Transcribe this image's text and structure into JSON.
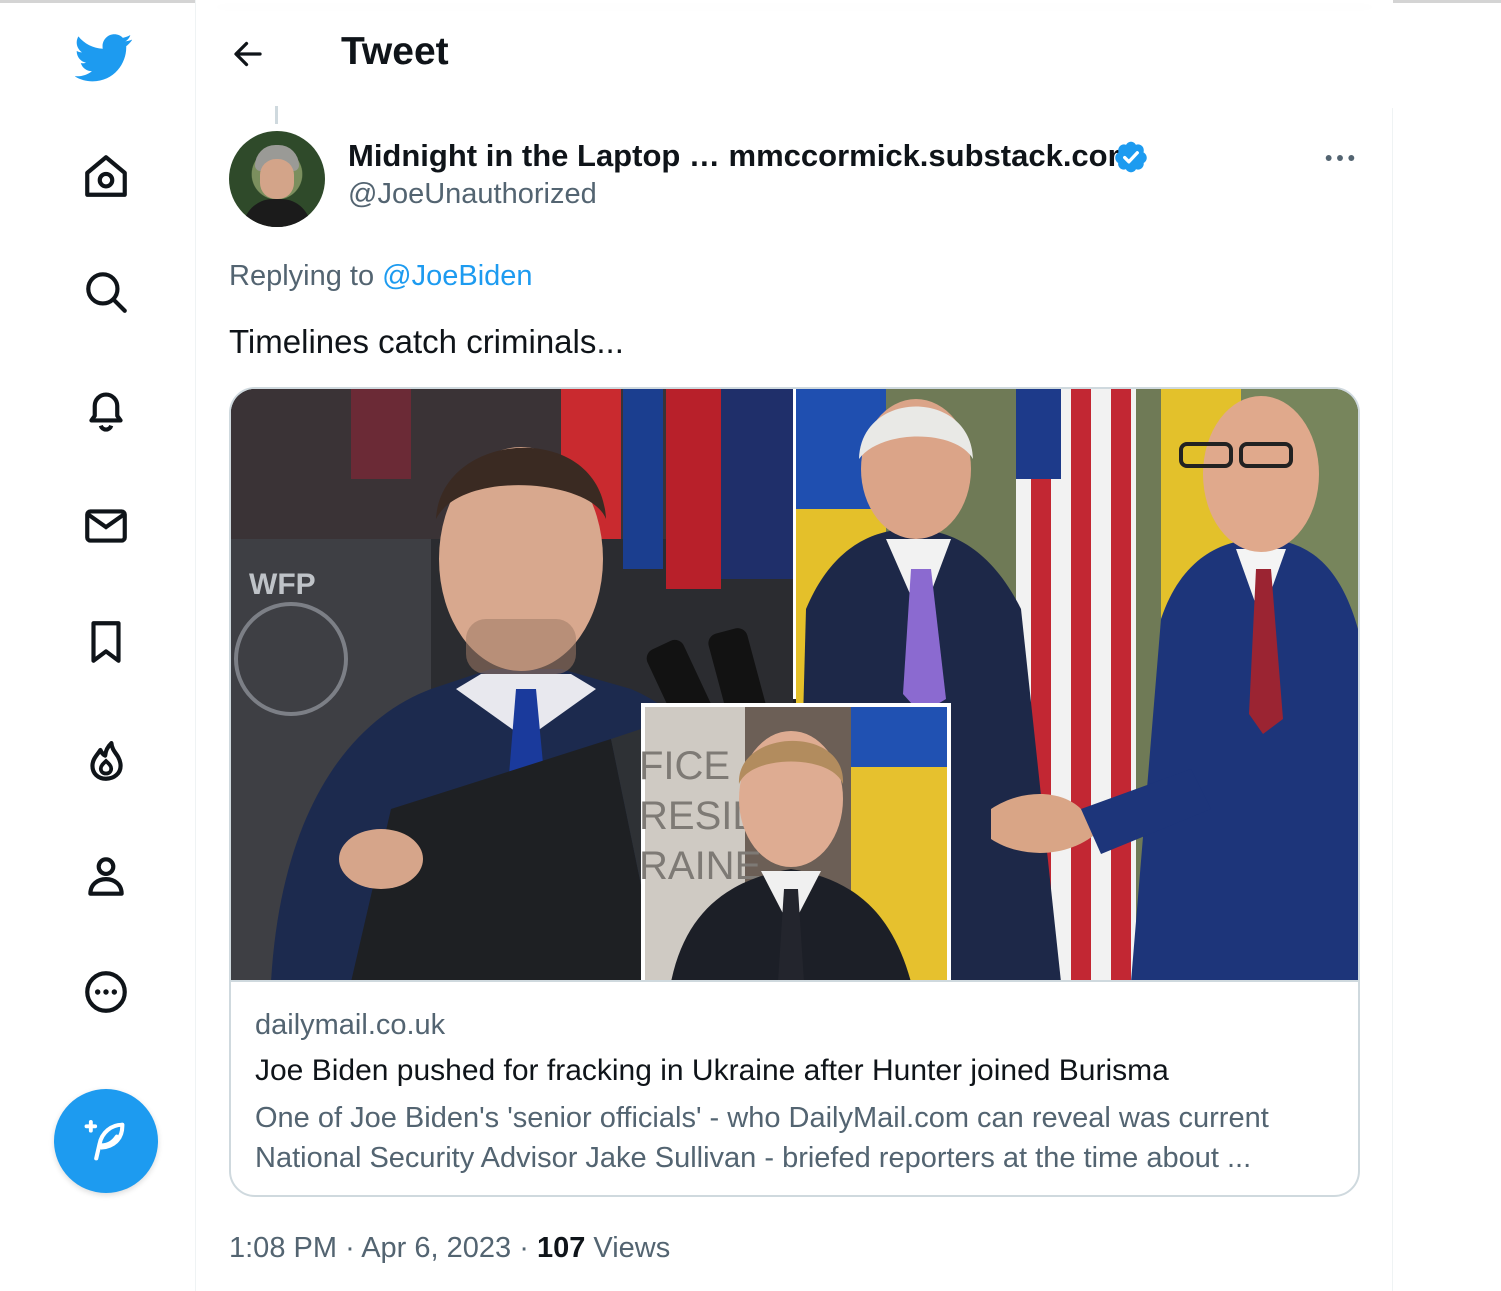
{
  "header": {
    "title": "Tweet"
  },
  "sidebar": {
    "items": [
      {
        "icon": "home-icon"
      },
      {
        "icon": "search-icon"
      },
      {
        "icon": "bell-icon"
      },
      {
        "icon": "mail-icon"
      },
      {
        "icon": "bookmark-icon"
      },
      {
        "icon": "flame-icon"
      },
      {
        "icon": "person-icon"
      },
      {
        "icon": "more-circle-icon"
      }
    ],
    "compose_icon": "feather-plus-icon"
  },
  "tweet": {
    "author": {
      "display_name": "Midnight in the Laptop … mmccormick.substack.com",
      "handle": "@JoeUnauthorized",
      "verified": true
    },
    "replying_prefix": "Replying to",
    "replying_to": "@JoeBiden",
    "text": "Timelines catch criminals...",
    "card": {
      "domain": "dailymail.co.uk",
      "headline": "Joe Biden pushed for fracking in Ukraine after Hunter joined Burisma",
      "description": "One of Joe Biden's 'senior officials' - who DailyMail.com can reveal was current National Security Advisor Jake Sullivan - briefed reporters at the time about ...",
      "image_text": {
        "wfp": "WFP",
        "office_line1": "FICE",
        "office_line2": "RESID",
        "office_line3": "RAINE"
      }
    },
    "time": "1:08 PM",
    "sep1": "·",
    "date": "Apr 6, 2023",
    "sep2": "·",
    "views_count": "107",
    "views_label": "Views"
  },
  "colors": {
    "accent": "#1d9bf0",
    "text_primary": "#0f1419",
    "text_secondary": "#536471",
    "border": "#cfd9de"
  }
}
